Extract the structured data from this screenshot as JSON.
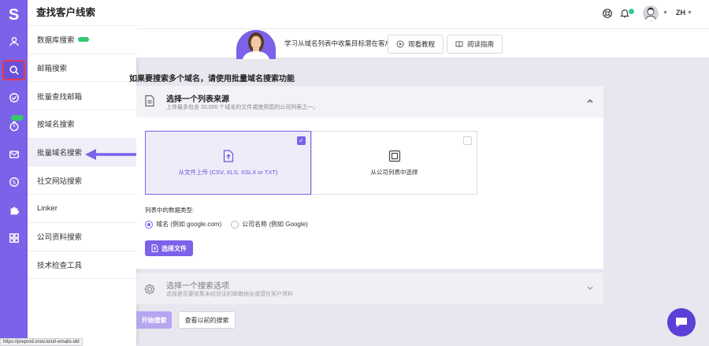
{
  "app": {
    "logo_letter": "S",
    "accent": "#7b62e8",
    "alert": "#e53950"
  },
  "rail": {
    "icons": [
      "user-icon",
      "search-icon",
      "check-circle-icon",
      "timer-icon",
      "mail-icon",
      "dollar-icon",
      "puzzle-icon",
      "grid-icon"
    ],
    "active": "search-icon"
  },
  "nav": {
    "title": "查找客户线索",
    "items": [
      {
        "label": "数据库搜索",
        "badge": true
      },
      {
        "label": "邮箱搜索"
      },
      {
        "label": "批量查找邮箱"
      },
      {
        "label": "按域名搜索"
      },
      {
        "label": "批量域名搜索",
        "selected": true
      },
      {
        "label": "社交网站搜索"
      },
      {
        "label": "Linker"
      },
      {
        "label": "公司资料搜索"
      },
      {
        "label": "技术检查工具"
      }
    ]
  },
  "header": {
    "lang": "ZH"
  },
  "tutorial": {
    "text": "学习从域名列表中收集目标潜在客户",
    "watch_label": "观看教程",
    "guide_label": "阅读指南"
  },
  "page": {
    "heading": "如果要搜索多个域名，请使用批量域名搜索功能"
  },
  "step1": {
    "title": "选择一个列表来源",
    "subtitle": "上传最多包含 20,000 个域名的文件或使用您的公司列表之一。",
    "upload_label": "从文件上传 (CSV, XLS, XSLX or TXT)",
    "company_list_label": "从公司列表中选择",
    "data_type_label": "列表中的数据类型:",
    "radio_domain": "域名 (例如 google.com)",
    "radio_company": "公司名称 (例如 Google)",
    "choose_file_label": "选择文件"
  },
  "step2": {
    "title": "选择一个搜索选项",
    "subtitle": "选择是否要收集未经验证的邮箱地址或潜在客户资料"
  },
  "actions": {
    "start_label": "开始搜索",
    "previous_label": "查看以前的搜索"
  },
  "status_url": "https://preprod.snov.io/url-emails-old"
}
